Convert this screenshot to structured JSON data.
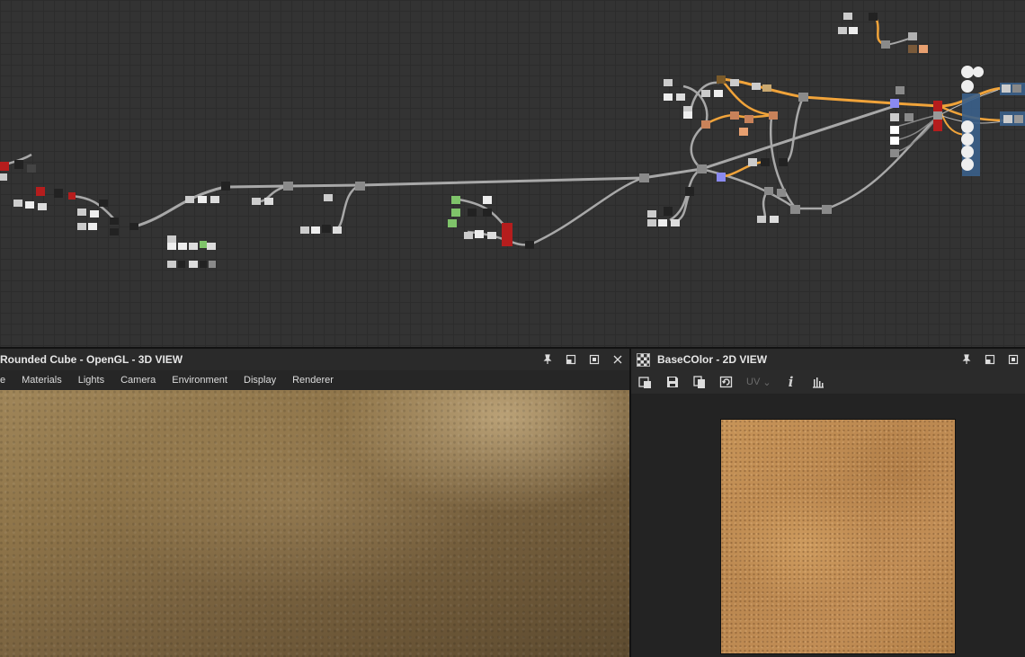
{
  "view3d": {
    "title": "Rounded Cube - OpenGL - 3D VIEW",
    "menu": [
      "e",
      "Materials",
      "Lights",
      "Camera",
      "Environment",
      "Display",
      "Renderer"
    ]
  },
  "view2d": {
    "title": "BaseCOlor - 2D VIEW",
    "uv_label": "UV",
    "info_label": "i"
  },
  "colors": {
    "graph_bg": "#333333",
    "wire_gray": "#a8a8a8",
    "wire_orange": "#f0a33a",
    "node_red": "#b51d1d",
    "node_gray": "#8a8a8a",
    "node_blue": "#8a8af0",
    "node_green": "#7fc46a"
  },
  "icons": {
    "pin": "pin-icon",
    "restore": "restore-icon",
    "maximize": "maximize-icon",
    "close": "close-icon"
  }
}
